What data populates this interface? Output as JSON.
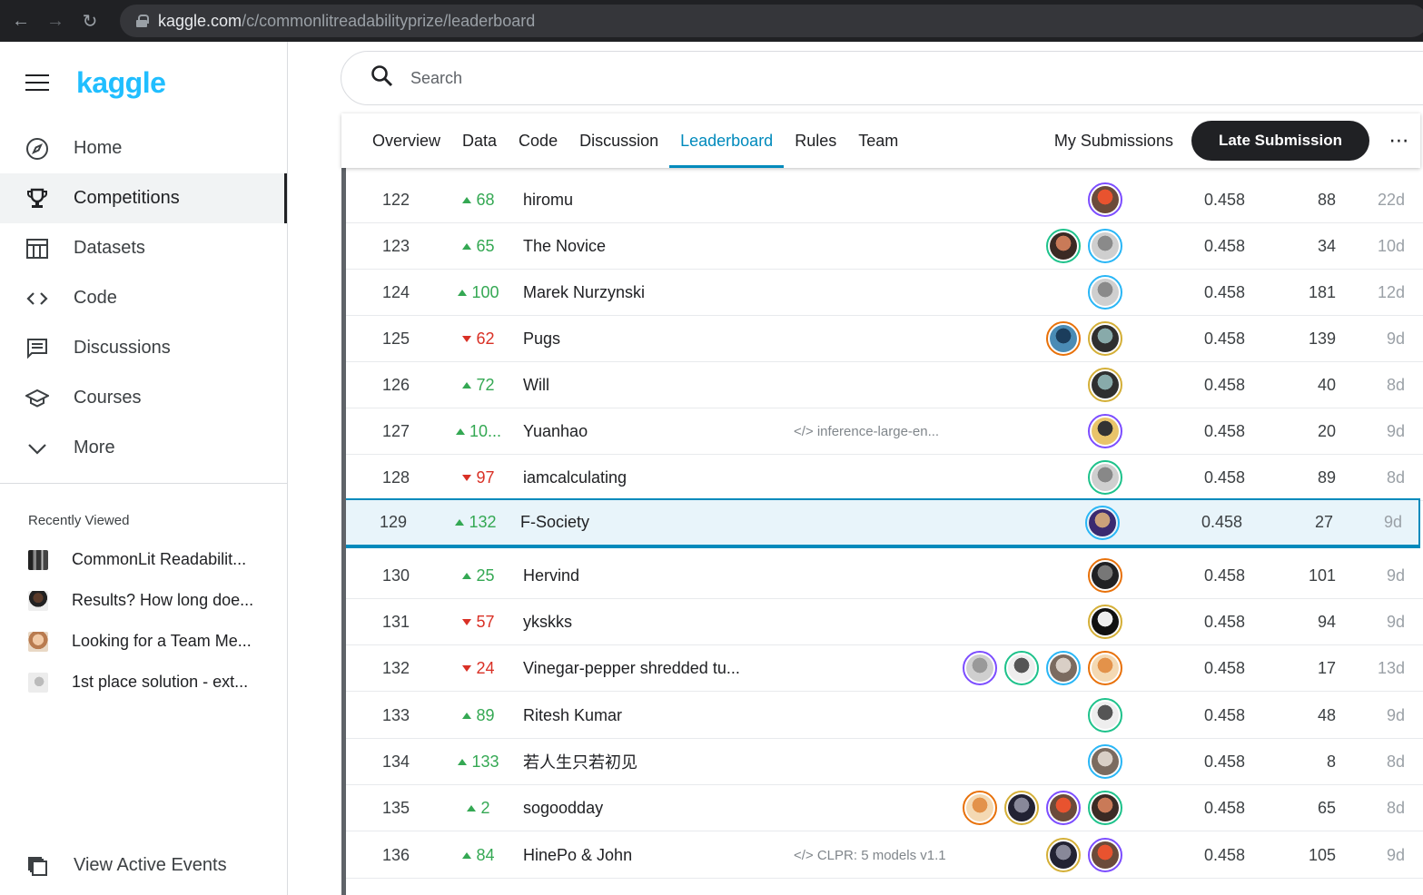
{
  "browser": {
    "url_host": "kaggle.com",
    "url_path": "/c/commonlitreadabilityprize/leaderboard"
  },
  "sidebar": {
    "logo": "kaggle",
    "items": [
      {
        "label": "Home",
        "icon": "compass-icon"
      },
      {
        "label": "Competitions",
        "icon": "trophy-icon"
      },
      {
        "label": "Datasets",
        "icon": "table-icon"
      },
      {
        "label": "Code",
        "icon": "code-icon"
      },
      {
        "label": "Discussions",
        "icon": "comment-icon"
      },
      {
        "label": "Courses",
        "icon": "school-icon"
      },
      {
        "label": "More",
        "icon": "chevron-down-icon"
      }
    ],
    "recently_viewed_title": "Recently Viewed",
    "recently_viewed": [
      {
        "label": "CommonLit Readabilit..."
      },
      {
        "label": "Results? How long doe..."
      },
      {
        "label": "Looking for a Team Me..."
      },
      {
        "label": "1st place solution - ext..."
      }
    ],
    "bottom_label": "View Active Events"
  },
  "search": {
    "placeholder": "Search"
  },
  "tabs": {
    "items": [
      {
        "label": "Overview"
      },
      {
        "label": "Data"
      },
      {
        "label": "Code"
      },
      {
        "label": "Discussion"
      },
      {
        "label": "Leaderboard"
      },
      {
        "label": "Rules"
      },
      {
        "label": "Team"
      }
    ],
    "my_submissions": "My Submissions",
    "late_submission": "Late Submission",
    "more": "⋯"
  },
  "leaderboard": {
    "rows": [
      {
        "rank": "122",
        "dir": "up",
        "delta": "68",
        "team": "hiromu",
        "notebook": "",
        "avatars": 1,
        "score": "0.458",
        "entries": "88",
        "last": "22d"
      },
      {
        "rank": "123",
        "dir": "up",
        "delta": "65",
        "team": "The Novice",
        "notebook": "",
        "avatars": 2,
        "score": "0.458",
        "entries": "34",
        "last": "10d"
      },
      {
        "rank": "124",
        "dir": "up",
        "delta": "100",
        "team": "Marek Nurzynski",
        "notebook": "",
        "avatars": 1,
        "score": "0.458",
        "entries": "181",
        "last": "12d"
      },
      {
        "rank": "125",
        "dir": "down",
        "delta": "62",
        "team": "Pugs",
        "notebook": "",
        "avatars": 2,
        "score": "0.458",
        "entries": "139",
        "last": "9d"
      },
      {
        "rank": "126",
        "dir": "up",
        "delta": "72",
        "team": "Will",
        "notebook": "",
        "avatars": 1,
        "score": "0.458",
        "entries": "40",
        "last": "8d"
      },
      {
        "rank": "127",
        "dir": "up",
        "delta": "10...",
        "team": "Yuanhao",
        "notebook": "</> inference-large-en...",
        "avatars": 1,
        "score": "0.458",
        "entries": "20",
        "last": "9d"
      },
      {
        "rank": "128",
        "dir": "down",
        "delta": "97",
        "team": "iamcalculating",
        "notebook": "",
        "avatars": 1,
        "score": "0.458",
        "entries": "89",
        "last": "8d"
      },
      {
        "rank": "129",
        "dir": "up",
        "delta": "132",
        "team": "F-Society",
        "notebook": "",
        "avatars": 1,
        "score": "0.458",
        "entries": "27",
        "last": "9d",
        "me": true
      },
      {
        "rank": "130",
        "dir": "up",
        "delta": "25",
        "team": "Hervind",
        "notebook": "",
        "avatars": 1,
        "score": "0.458",
        "entries": "101",
        "last": "9d"
      },
      {
        "rank": "131",
        "dir": "down",
        "delta": "57",
        "team": "ykskks",
        "notebook": "",
        "avatars": 1,
        "score": "0.458",
        "entries": "94",
        "last": "9d"
      },
      {
        "rank": "132",
        "dir": "down",
        "delta": "24",
        "team": "Vinegar-pepper shredded tu...",
        "notebook": "",
        "avatars": 4,
        "score": "0.458",
        "entries": "17",
        "last": "13d"
      },
      {
        "rank": "133",
        "dir": "up",
        "delta": "89",
        "team": "Ritesh Kumar",
        "notebook": "",
        "avatars": 1,
        "score": "0.458",
        "entries": "48",
        "last": "9d"
      },
      {
        "rank": "134",
        "dir": "up",
        "delta": "133",
        "team": "若人生只若初见",
        "notebook": "",
        "avatars": 1,
        "score": "0.458",
        "entries": "8",
        "last": "8d"
      },
      {
        "rank": "135",
        "dir": "up",
        "delta": "2",
        "team": "sogoodday",
        "notebook": "",
        "avatars": 4,
        "score": "0.458",
        "entries": "65",
        "last": "8d"
      },
      {
        "rank": "136",
        "dir": "up",
        "delta": "84",
        "team": "HinePo & John",
        "notebook": "</> CLPR: 5 models v1.1",
        "avatars": 2,
        "score": "0.458",
        "entries": "105",
        "last": "9d"
      }
    ]
  },
  "colors": {
    "accent": "#008abc",
    "brand": "#20beff",
    "up": "#34a853",
    "down": "#d93025"
  }
}
